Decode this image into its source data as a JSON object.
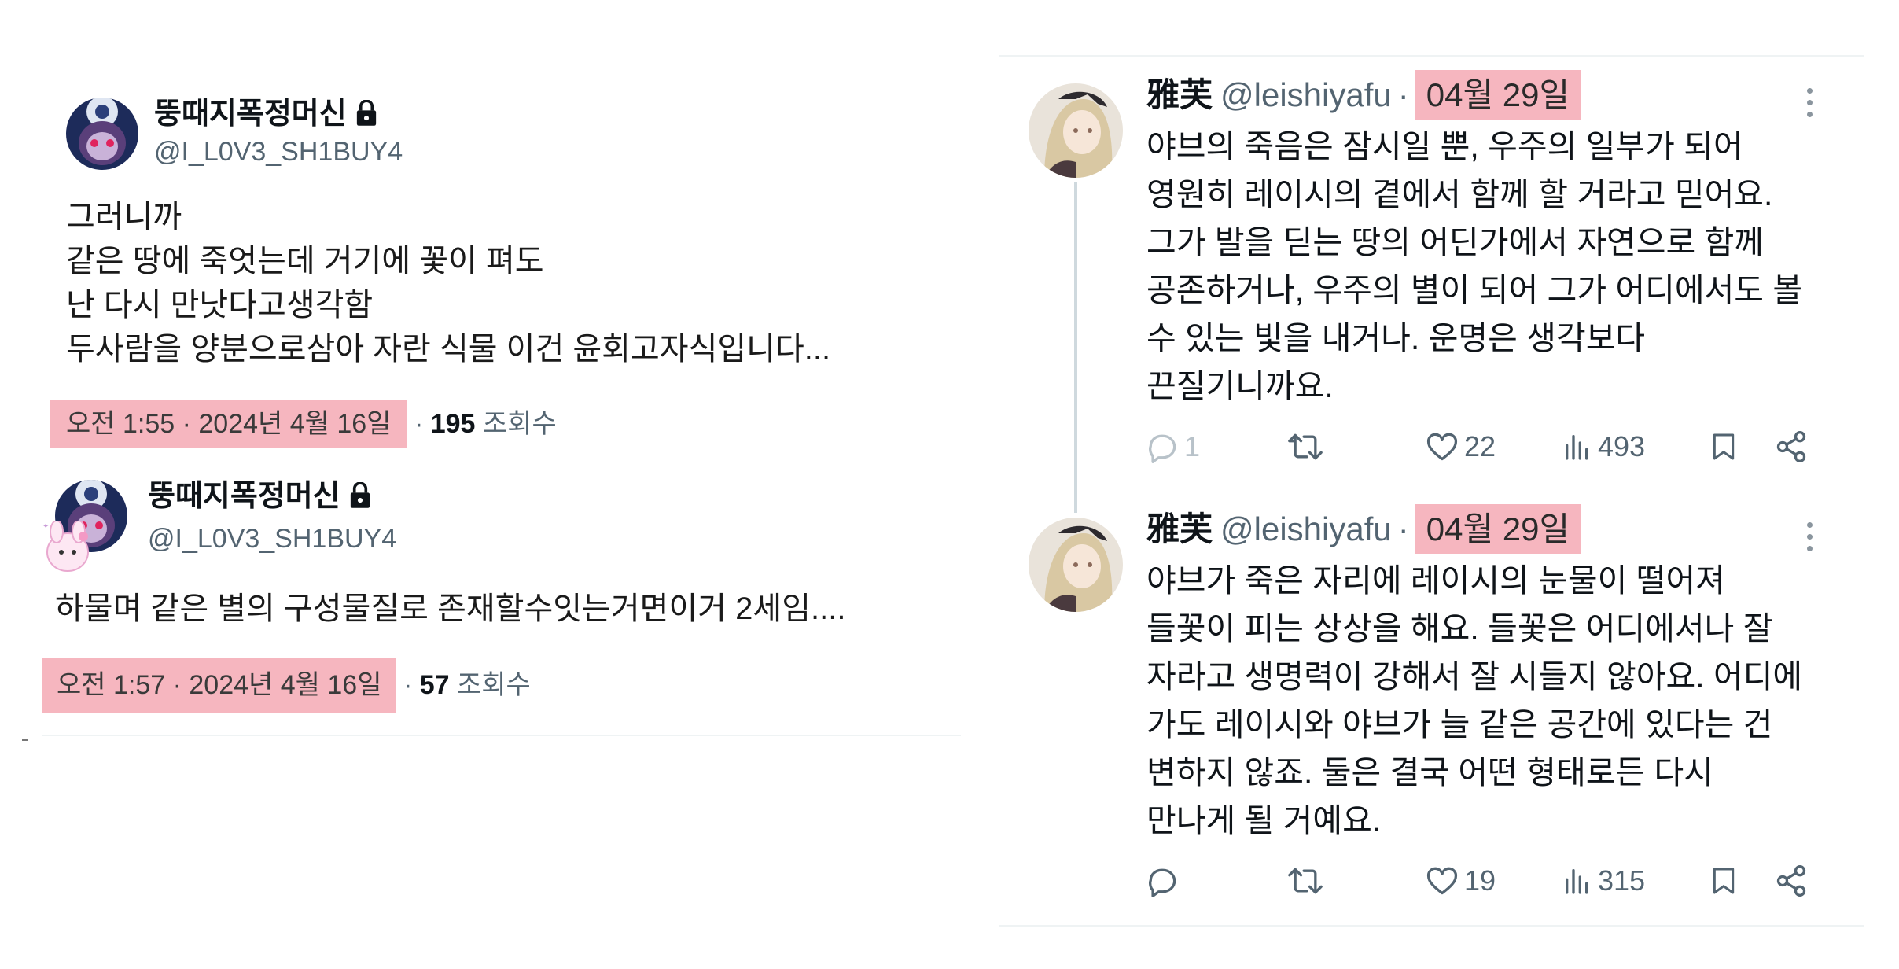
{
  "left_tweets": [
    {
      "name": "뚱때지폭정머신",
      "handle": "@I_L0V3_SH1BUY4",
      "lines": [
        "그러니까",
        "같은 땅에 죽엇는데 거기에 꽃이 펴도",
        "난 다시 만낫다고생각함",
        "두사람을 양분으로삼아 자란 식물 이건 윤회고자식입니다..."
      ],
      "timestamp": "오전 1:55 · 2024년 4월 16일",
      "views_count": "195",
      "views_label": "조회수"
    },
    {
      "name": "뚱때지폭정머신",
      "handle": "@I_L0V3_SH1BUY4",
      "lines": [
        "하물며 같은 별의 구성물질로 존재할수잇는거면이거 2세임...."
      ],
      "timestamp": "오전 1:57 · 2024년 4월 16일",
      "views_count": "57",
      "views_label": "조회수"
    }
  ],
  "right_tweets": [
    {
      "name": "雅芙",
      "handle": "@leishiyafu",
      "date": "04월 29일",
      "lines": [
        "야브의 죽음은 잠시일 뿐, 우주의 일부가 되어",
        "영원히 레이시의 곁에서 함께 할 거라고 믿어요.",
        "그가 발을 딛는 땅의 어딘가에서 자연으로 함께",
        "공존하거나, 우주의 별이 되어 그가 어디에서도 볼",
        "수 있는 빛을 내거나. 운명은 생각보다",
        "끈질기니까요."
      ],
      "replies": "1",
      "likes": "22",
      "views": "493"
    },
    {
      "name": "雅芙",
      "handle": "@leishiyafu",
      "date": "04월 29일",
      "lines": [
        "야브가 죽은 자리에 레이시의 눈물이 떨어져",
        "들꽃이 피는 상상을 해요. 들꽃은 어디에서나 잘",
        "자라고 생명력이 강해서 잘 시들지 않아요. 어디에",
        "가도 레이시와 야브가 늘 같은 공간에 있다는 건",
        "변하지 않죠. 둘은 결국 어떤 형태로든 다시",
        "만나게 될 거예요."
      ],
      "replies": "",
      "likes": "19",
      "views": "315"
    }
  ],
  "icons": [
    "lock-icon",
    "reply-icon",
    "retweet-icon",
    "like-icon",
    "views-icon",
    "bookmark-icon",
    "share-icon",
    "more-icon"
  ],
  "colors": {
    "highlight": "#f6b6bf",
    "muted": "#536471",
    "text": "#0f1419"
  }
}
